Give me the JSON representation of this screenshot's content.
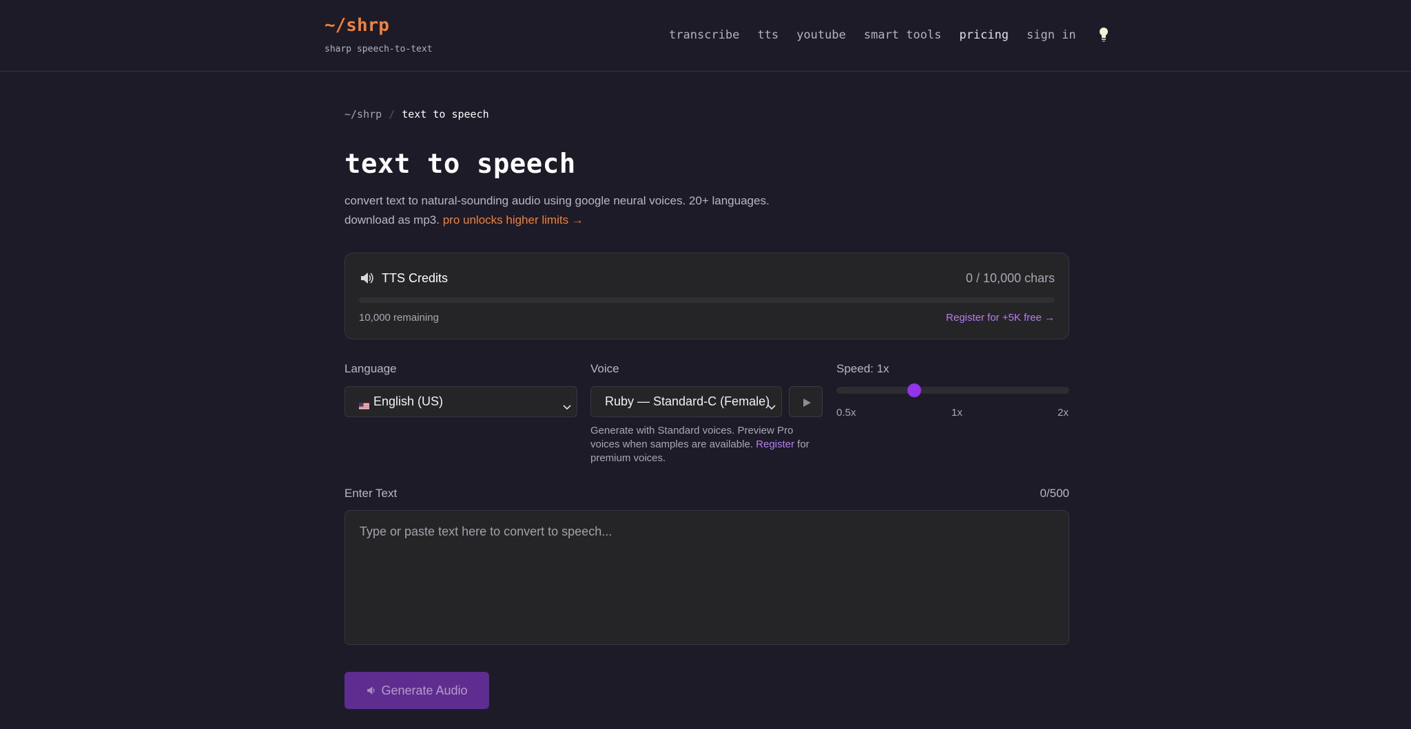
{
  "header": {
    "logo": "~/shrp",
    "tagline": "sharp speech-to-text",
    "nav": [
      "transcribe",
      "tts",
      "youtube",
      "smart tools",
      "pricing",
      "sign in"
    ],
    "theme_icon": "lightbulb-icon"
  },
  "breadcrumb": {
    "root": "~/shrp",
    "separator": "/",
    "current": "text to speech"
  },
  "page": {
    "title": "text to speech",
    "description": "convert text to natural-sounding audio using google neural voices. 20+ languages. download as mp3.",
    "pro_link": "pro unlocks higher limits →"
  },
  "credits": {
    "icon": "speaker-icon",
    "title": "TTS Credits",
    "usage": "0 / 10,000 chars",
    "progress_fraction": 0,
    "remaining": "10,000 remaining",
    "register_link": "Register for +5K free →"
  },
  "language": {
    "label": "Language",
    "flag_icon": "us-flag-icon",
    "selected": "English (US)"
  },
  "voice": {
    "label": "Voice",
    "selected": "Ruby — Standard-C (Female)",
    "hint_before": "Generate with Standard voices. Preview Pro voices when samples are available.",
    "hint_link": "Register",
    "hint_after": "for premium voices."
  },
  "speed": {
    "label": "Speed: 1x",
    "value": 1,
    "min": 0.5,
    "max": 2,
    "ticks": [
      "0.5x",
      "1x",
      "2x"
    ]
  },
  "text_input": {
    "label": "Enter Text",
    "count": "0/500",
    "placeholder": "Type or paste text here to convert to speech..."
  },
  "generate": {
    "icon": "speaker-icon",
    "label": "Generate Audio"
  },
  "colors": {
    "accent_orange": "#f0823a",
    "accent_purple": "#9333ea",
    "link_purple": "#b57ff0",
    "background": "#1c1b27"
  }
}
